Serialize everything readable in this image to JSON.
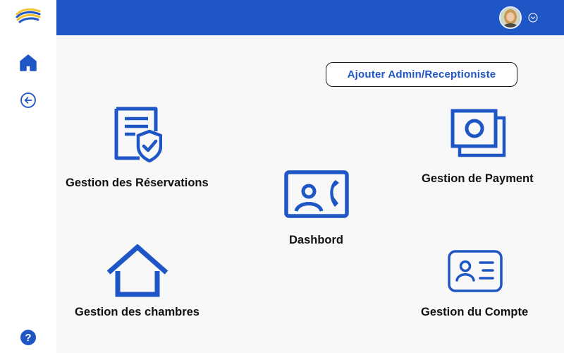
{
  "sidebar": {
    "logo": "brand-logo",
    "items": [
      {
        "icon": "home-icon"
      },
      {
        "icon": "back-arrow-icon"
      }
    ],
    "help_icon": "help-icon"
  },
  "header": {
    "avatar": "user-avatar",
    "menu_icon": "chevron-down-icon"
  },
  "main": {
    "add_button_label": "Ajouter Admin/Receptioniste",
    "tiles": [
      {
        "label": "Gestion des Réservations",
        "icon": "reservation-document-icon"
      },
      {
        "label": "Dashbord",
        "icon": "dashboard-contact-icon"
      },
      {
        "label": "Gestion de Payment",
        "icon": "money-bills-icon"
      },
      {
        "label": "Gestion des chambres",
        "icon": "house-icon"
      },
      {
        "label": "Gestion du Compte",
        "icon": "id-card-icon"
      }
    ]
  },
  "colors": {
    "primary": "#1f56c6",
    "background": "#f8f8f9",
    "sidebar": "#ffffff",
    "text": "#111111"
  }
}
